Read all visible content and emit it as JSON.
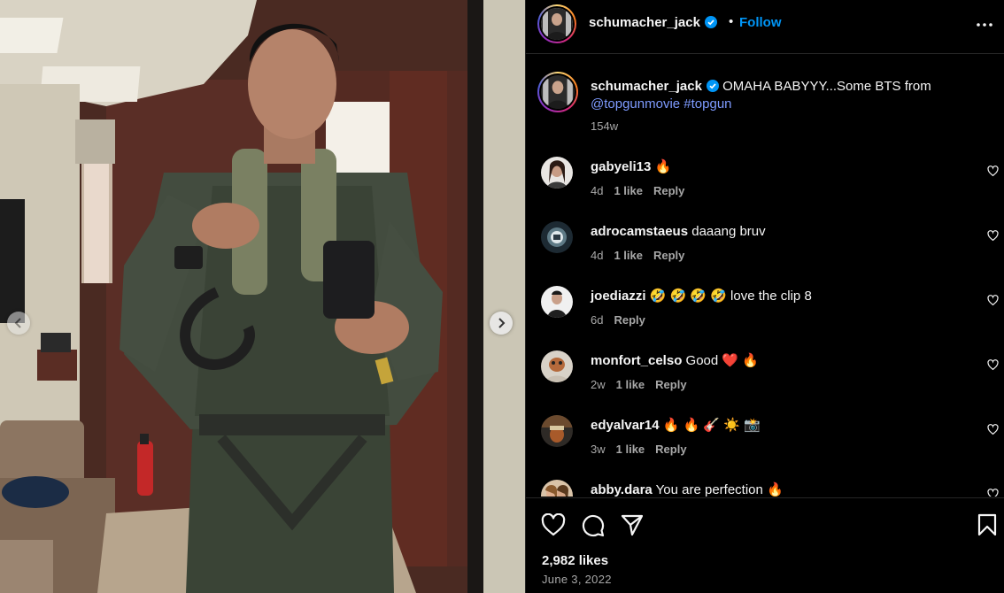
{
  "post": {
    "author": "schumacher_jack",
    "follow_label": "Follow",
    "dot": "•",
    "caption_text": " OMAHA BABYYY...Some BTS from ",
    "caption_mention": "@topgunmovie",
    "caption_hashtag": "#topgun",
    "caption_age": "154w",
    "likes": "2,982 likes",
    "date": "June 3, 2022"
  },
  "comments": [
    {
      "user": "gabyeli13",
      "text": " 🔥",
      "age": "4d",
      "likes": "1 like",
      "reply": "Reply"
    },
    {
      "user": "adrocamstaeus",
      "text": " daaang bruv",
      "age": "4d",
      "likes": "1 like",
      "reply": "Reply"
    },
    {
      "user": "joediazzi",
      "text": " 🤣 🤣 🤣 🤣  love the clip 8",
      "age": "6d",
      "likes": "",
      "reply": "Reply"
    },
    {
      "user": "monfort_celso",
      "text": " Good ❤️ 🔥",
      "age": "2w",
      "likes": "1 like",
      "reply": "Reply"
    },
    {
      "user": "edyalvar14",
      "text": " 🔥 🔥 🎸 ☀️ 📸",
      "age": "3w",
      "likes": "1 like",
      "reply": "Reply"
    },
    {
      "user": "abby.dara",
      "text": " You are perfection 🔥",
      "age": "",
      "likes": "",
      "reply": ""
    }
  ],
  "icons": {
    "verified": "verified-badge-icon",
    "more": "more-horizontal-icon",
    "like": "heart-icon",
    "comment": "comment-icon",
    "share": "paper-plane-icon",
    "save": "bookmark-icon",
    "prev": "chevron-left-icon",
    "next": "chevron-right-icon"
  },
  "colors": {
    "accent": "#0095f6",
    "link": "#7e9bff",
    "background": "#000000",
    "secondary_text": "#a8a8a8"
  }
}
